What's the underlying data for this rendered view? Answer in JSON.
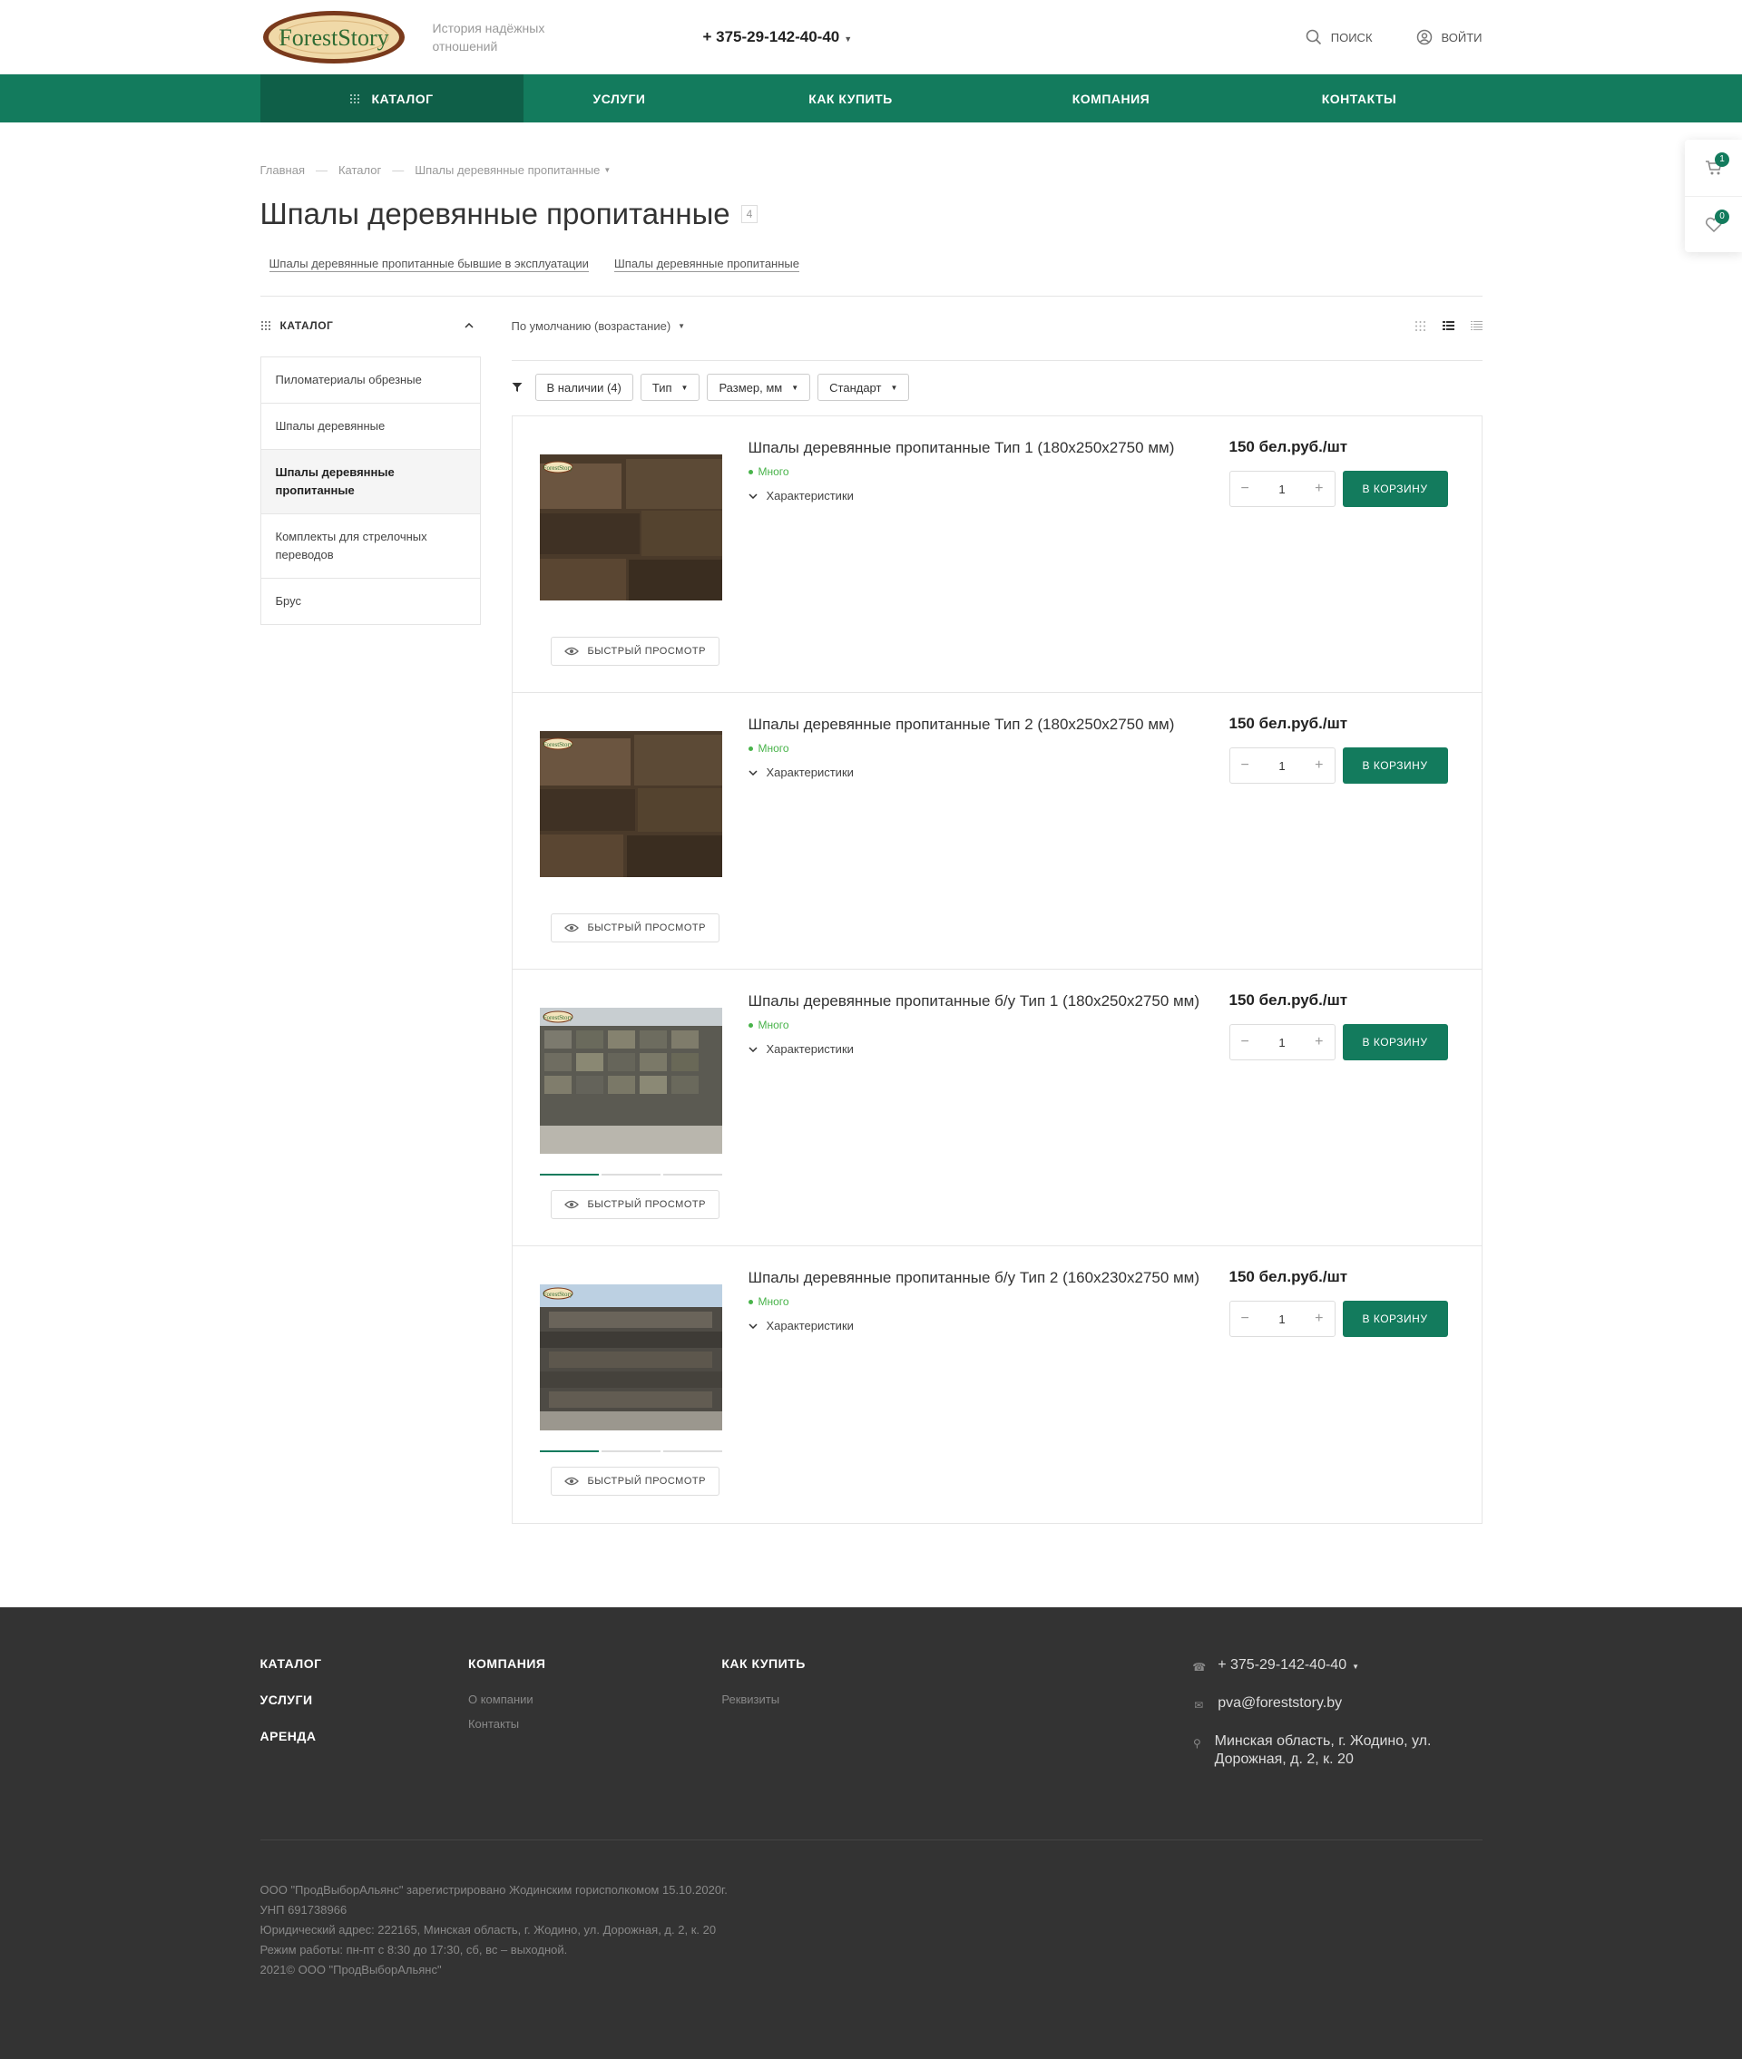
{
  "header": {
    "logo_text": "ForestStory",
    "slogan": "История надёжных отношений",
    "phone": "+ 375-29-142-40-40",
    "search_label": "Поиск",
    "login_label": "Войти"
  },
  "nav": {
    "items": [
      {
        "label": "Каталог"
      },
      {
        "label": "Услуги"
      },
      {
        "label": "Как купить"
      },
      {
        "label": "Компания"
      },
      {
        "label": "Контакты"
      }
    ]
  },
  "side_panel": {
    "cart_count": "1",
    "favorites_count": "0"
  },
  "breadcrumbs": [
    "Главная",
    "Каталог",
    "Шпалы деревянные пропитанные"
  ],
  "page": {
    "title": "Шпалы деревянные пропитанные",
    "count": "4",
    "subsections": [
      "Шпалы деревянные пропитанные бывшие в эксплуатации",
      "Шпалы деревянные пропитанные"
    ]
  },
  "sidebar": {
    "title": "Каталог",
    "items": [
      {
        "label": "Пиломатериалы обрезные"
      },
      {
        "label": "Шпалы деревянные"
      },
      {
        "label": "Шпалы деревянные пропитанные"
      },
      {
        "label": "Комплекты для стрелочных переводов"
      },
      {
        "label": "Брус"
      }
    ]
  },
  "sort": {
    "label": "По умолчанию (возрастание)"
  },
  "filters": {
    "items": [
      "В наличии (4)",
      "Тип",
      "Размер, мм",
      "Стандарт"
    ]
  },
  "products": [
    {
      "name": "Шпалы деревянные пропитанные Тип 1 (180х250х2750 мм)",
      "stock": "Много",
      "chars": "Характеристики",
      "price": "150 бел.руб./шт",
      "qty": "1",
      "cart": "В корзину",
      "quick_view": "Быстрый просмотр"
    },
    {
      "name": "Шпалы деревянные пропитанные Тип 2 (180х250х2750 мм)",
      "stock": "Много",
      "chars": "Характеристики",
      "price": "150 бел.руб./шт",
      "qty": "1",
      "cart": "В корзину",
      "quick_view": "Быстрый просмотр"
    },
    {
      "name": "Шпалы деревянные пропитанные б/у Тип 1 (180х250х2750 мм)",
      "stock": "Много",
      "chars": "Характеристики",
      "price": "150 бел.руб./шт",
      "qty": "1",
      "cart": "В корзину",
      "quick_view": "Быстрый просмотр"
    },
    {
      "name": "Шпалы деревянные пропитанные б/у Тип 2 (160х230х2750 мм)",
      "stock": "Много",
      "chars": "Характеристики",
      "price": "150 бел.руб./шт",
      "qty": "1",
      "cart": "В корзину",
      "quick_view": "Быстрый просмотр"
    }
  ],
  "footer": {
    "col1": [
      "Каталог",
      "Услуги",
      "Аренда"
    ],
    "col2_title": "Компания",
    "col2_links": [
      "О компании",
      "Контакты"
    ],
    "col3_title": "Как купить",
    "col3_links": [
      "Реквизиты"
    ],
    "phone": "+ 375-29-142-40-40",
    "email": "pva@foreststory.by",
    "address": "Минская область, г. Жодино, ул. Дорожная, д. 2, к. 20",
    "legal": [
      "ООО \"ПродВыборАльянс\" зарегистрировано Жодинским горисполкомом 15.10.2020г.",
      "УНП 691738966",
      "Юридический адрес: 222165, Минская область, г. Жодино, ул. Дорожная, д. 2, к. 20",
      "Режим работы: пн-пт с 8:30 до 17:30, сб, вс – выходной.",
      "2021© ООО \"ПродВыборАльянс\""
    ]
  },
  "colors": {
    "brand_green": "#137b5d",
    "nav_active": "#0f5f48",
    "stock_green": "#48b34a",
    "footer_bg": "#333333"
  }
}
